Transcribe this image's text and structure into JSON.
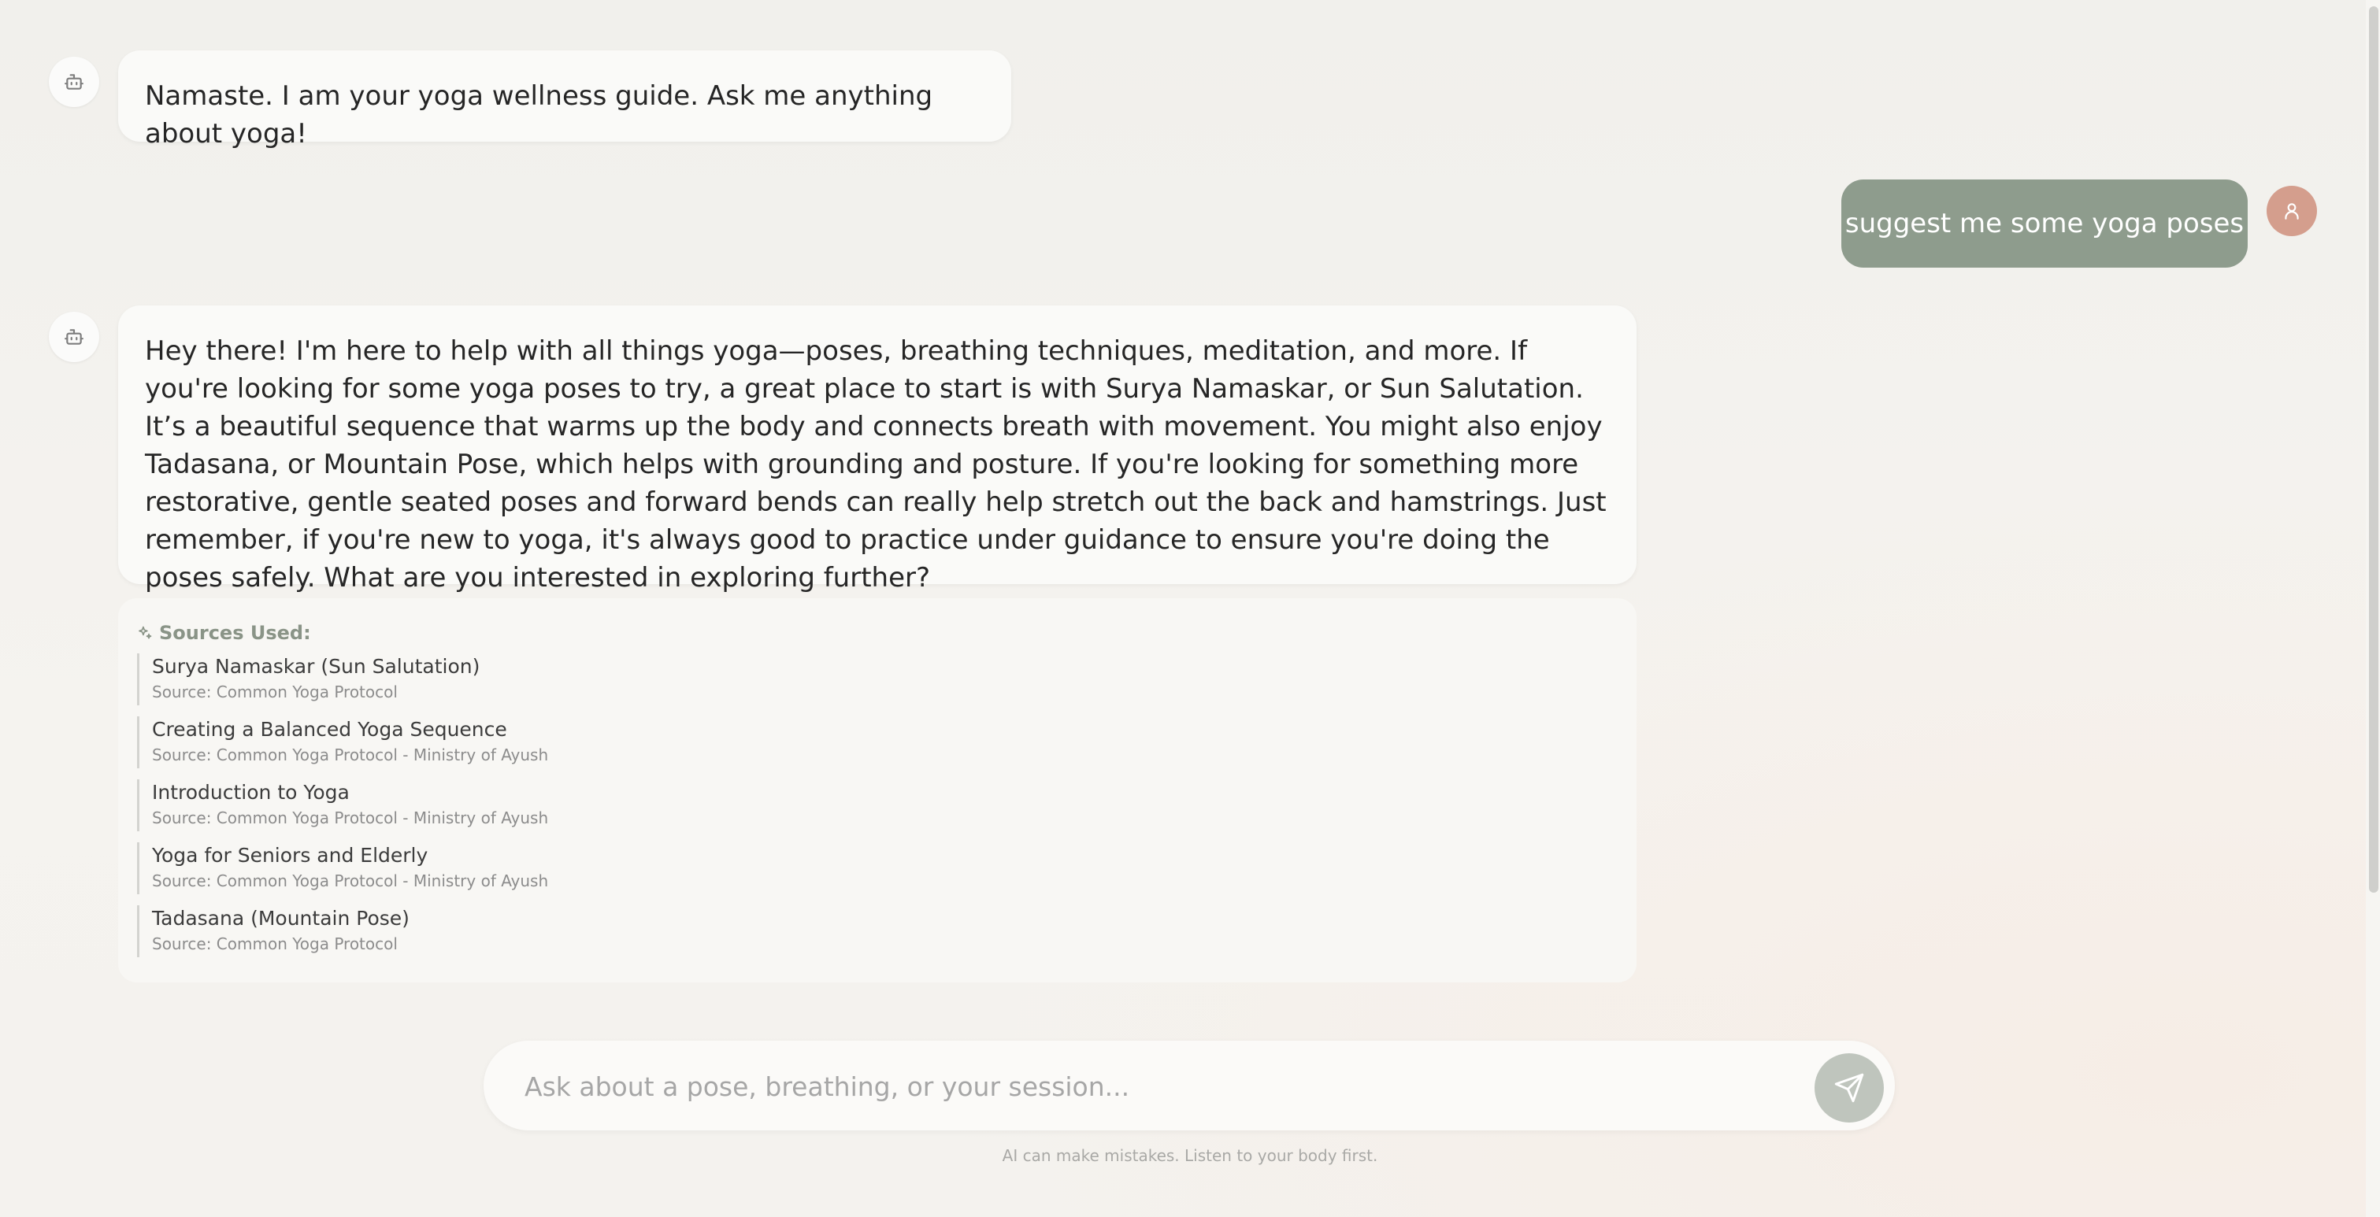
{
  "messages": [
    {
      "role": "assistant",
      "text": "Namaste. I am your yoga wellness guide. Ask me anything about yoga!"
    },
    {
      "role": "user",
      "text": "suggest me some yoga poses"
    },
    {
      "role": "assistant",
      "text": "Hey there! I'm here to help with all things yoga—poses, breathing techniques, meditation, and more. If you're looking for some yoga poses to try, a great place to start is with Surya Namaskar, or Sun Salutation. It’s a beautiful sequence that warms up the body and connects breath with movement. You might also enjoy Tadasana, or Mountain Pose, which helps with grounding and posture. If you're looking for something more restorative, gentle seated poses and forward bends can really help stretch out the back and hamstrings. Just remember, if you're new to yoga, it's always good to practice under guidance to ensure you're doing the poses safely. What are you interested in exploring further?"
    }
  ],
  "sources": {
    "heading": "Sources Used:",
    "items": [
      {
        "title": "Surya Namaskar (Sun Salutation)",
        "source": "Source: Common Yoga Protocol"
      },
      {
        "title": "Creating a Balanced Yoga Sequence",
        "source": "Source: Common Yoga Protocol - Ministry of Ayush"
      },
      {
        "title": "Introduction to Yoga",
        "source": "Source: Common Yoga Protocol - Ministry of Ayush"
      },
      {
        "title": "Yoga for Seniors and Elderly",
        "source": "Source: Common Yoga Protocol - Ministry of Ayush"
      },
      {
        "title": "Tadasana (Mountain Pose)",
        "source": "Source: Common Yoga Protocol"
      }
    ]
  },
  "composer": {
    "placeholder": "Ask about a pose, breathing, or your session...",
    "value": ""
  },
  "disclaimer": "AI can make mistakes. Listen to your body first.",
  "icons": {
    "assistant_avatar": "bot-icon",
    "user_avatar": "user-icon",
    "sources": "sparkles-icon",
    "send": "send-icon"
  },
  "colors": {
    "user_bubble": "#8e9c8d",
    "user_avatar": "#d49e8d",
    "send_button": "#bfc5bd",
    "sources_heading": "#8a9487"
  }
}
